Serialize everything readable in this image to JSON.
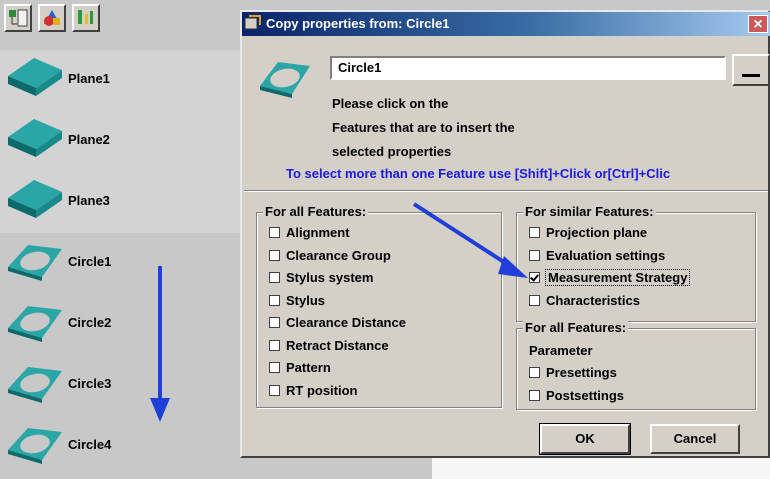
{
  "toolbar": {
    "buttons": [
      {
        "icon": "feature-tree-icon"
      },
      {
        "icon": "shapes-icon"
      },
      {
        "icon": "trace-icon"
      }
    ]
  },
  "tree": {
    "items": [
      {
        "label": "Plane1",
        "icon": "plane-icon"
      },
      {
        "label": "Plane2",
        "icon": "plane-icon"
      },
      {
        "label": "Plane3",
        "icon": "plane-icon"
      },
      {
        "label": "Circle1",
        "icon": "circle-feature-icon"
      },
      {
        "label": "Circle2",
        "icon": "circle-feature-icon"
      },
      {
        "label": "Circle3",
        "icon": "circle-feature-icon"
      },
      {
        "label": "Circle4",
        "icon": "circle-feature-icon"
      }
    ]
  },
  "dialog": {
    "title": "Copy properties from: Circle1",
    "close_label": "×",
    "name_value": "Circle1",
    "instructions": [
      "Please click on the",
      "Features that are to insert the",
      "selected properties"
    ],
    "hint": "To select more than one Feature use [Shift]+Click or[Ctrl]+Clic",
    "all_features": {
      "legend": "For all Features:",
      "options": [
        {
          "label": "Alignment",
          "checked": false
        },
        {
          "label": "Clearance Group",
          "checked": false
        },
        {
          "label": "Stylus system",
          "checked": false
        },
        {
          "label": "Stylus",
          "checked": false
        },
        {
          "label": "Clearance Distance",
          "checked": false
        },
        {
          "label": "Retract Distance",
          "checked": false
        },
        {
          "label": "Pattern",
          "checked": false
        },
        {
          "label": "RT position",
          "checked": false
        }
      ]
    },
    "similar_features": {
      "legend": "For similar Features:",
      "options": [
        {
          "label": "Projection plane",
          "checked": false
        },
        {
          "label": "Evaluation settings",
          "checked": false
        },
        {
          "label": "Measurement Strategy",
          "checked": true
        },
        {
          "label": "Characteristics",
          "checked": false
        }
      ]
    },
    "all_features_2": {
      "legend": "For all Features:",
      "sublabel": "Parameter",
      "options": [
        {
          "label": "Presettings",
          "checked": false
        },
        {
          "label": "Postsettings",
          "checked": false
        }
      ]
    },
    "ok_label": "OK",
    "cancel_label": "Cancel"
  },
  "colors": {
    "title_bar": "#0a246a",
    "hint_text": "#1c1ce0",
    "arrow": "#1f3fd8",
    "plane_icon": "#2aa6a6"
  }
}
